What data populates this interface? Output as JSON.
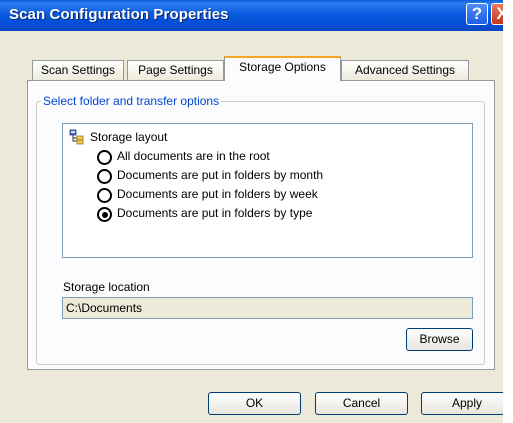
{
  "window": {
    "title": "Scan Configuration Properties"
  },
  "titlebar": {
    "help_glyph": "?",
    "close_glyph": "X",
    "help_icon": "help-icon",
    "close_icon": "close-icon"
  },
  "tabs": [
    {
      "label": "Scan Settings",
      "active": false
    },
    {
      "label": "Page Settings",
      "active": false
    },
    {
      "label": "Storage Options",
      "active": true
    },
    {
      "label": "Advanced Settings",
      "active": false
    }
  ],
  "group": {
    "label": "Select folder and transfer options"
  },
  "storage_layout": {
    "label": "Storage layout",
    "icon": "folder-tree-icon",
    "options": [
      {
        "label": "All documents are in the root",
        "selected": false
      },
      {
        "label": "Documents are put in folders by month",
        "selected": false
      },
      {
        "label": "Documents are put in folders by week",
        "selected": false
      },
      {
        "label": "Documents are put in folders by type",
        "selected": true
      }
    ]
  },
  "storage_location": {
    "label": "Storage location",
    "value": "C:\\Documents"
  },
  "buttons": {
    "browse": "Browse",
    "ok": "OK",
    "cancel": "Cancel",
    "apply": "Apply"
  },
  "colors": {
    "accent_tab": "#f5a623",
    "group_label": "#0046d5",
    "titlebar": "#0a5ae0"
  }
}
